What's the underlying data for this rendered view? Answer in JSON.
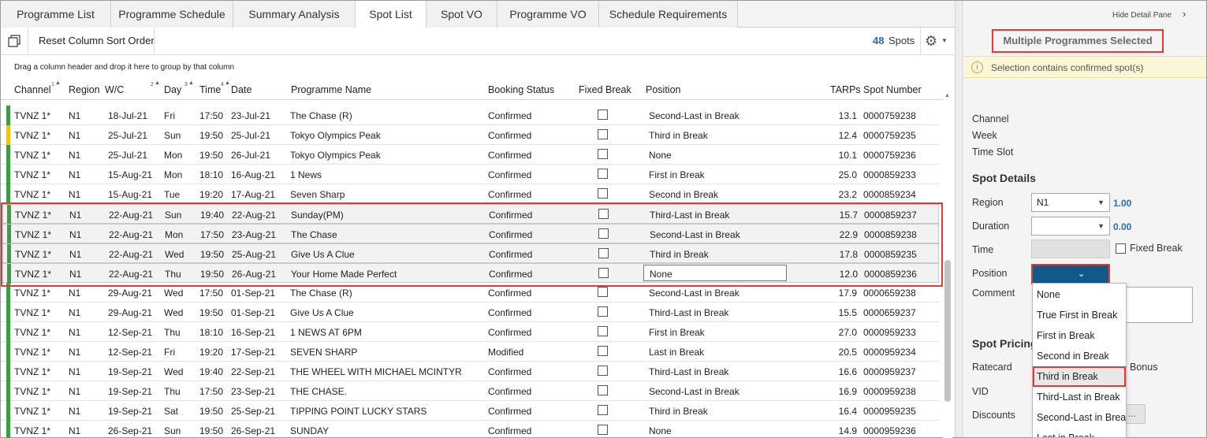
{
  "tabs": [
    {
      "label": "Programme List",
      "active": false
    },
    {
      "label": "Programme Schedule",
      "active": false
    },
    {
      "label": "Summary Analysis",
      "active": false
    },
    {
      "label": "Spot List",
      "active": true
    },
    {
      "label": "Spot VO",
      "active": false
    },
    {
      "label": "Programme VO",
      "active": false
    },
    {
      "label": "Schedule Requirements",
      "active": false
    }
  ],
  "toolbar": {
    "copy_icon": "copy-icon",
    "reset_label": "Reset Column Sort Order",
    "spot_count": "48",
    "spots_label": "Spots",
    "settings_icon": "gear-icon"
  },
  "group_hint": "Drag a column header and drop it here to group by that column",
  "columns": {
    "channel": "Channel",
    "region": "Region",
    "wc": "W/C",
    "day": "Day",
    "time": "Time",
    "date": "Date",
    "programme": "Programme Name",
    "booking": "Booking Status",
    "fixed_break": "Fixed Break",
    "position": "Position",
    "tarps": "TARPs",
    "spot_number": "Spot Number"
  },
  "sort_marks": {
    "channel": "1",
    "wc": "2",
    "day": "3",
    "time": "4"
  },
  "rows": [
    {
      "channel": "TVNZ 1*",
      "region": "N1",
      "wc": "18-Jul-21",
      "day": "Fri",
      "time": "17:50",
      "date": "23-Jul-21",
      "programme": "The Chase (R)",
      "booking": "Confirmed",
      "position": "Second-Last in Break",
      "tarps": "13.1",
      "spot_number": "0000759238",
      "stripe": "green",
      "selected": false
    },
    {
      "channel": "TVNZ 1*",
      "region": "N1",
      "wc": "25-Jul-21",
      "day": "Sun",
      "time": "19:50",
      "date": "25-Jul-21",
      "programme": "Tokyo Olympics Peak",
      "booking": "Confirmed",
      "position": "Third in Break",
      "tarps": "12.4",
      "spot_number": "0000759235",
      "stripe": "yellow",
      "selected": false
    },
    {
      "channel": "TVNZ 1*",
      "region": "N1",
      "wc": "25-Jul-21",
      "day": "Mon",
      "time": "19:50",
      "date": "26-Jul-21",
      "programme": "Tokyo Olympics Peak",
      "booking": "Confirmed",
      "position": "None",
      "tarps": "10.1",
      "spot_number": "0000759236",
      "stripe": "green",
      "selected": false
    },
    {
      "channel": "TVNZ 1*",
      "region": "N1",
      "wc": "15-Aug-21",
      "day": "Mon",
      "time": "18:10",
      "date": "16-Aug-21",
      "programme": "1 News",
      "booking": "Confirmed",
      "position": "First in Break",
      "tarps": "25.0",
      "spot_number": "0000859233",
      "stripe": "green",
      "selected": false
    },
    {
      "channel": "TVNZ 1*",
      "region": "N1",
      "wc": "15-Aug-21",
      "day": "Tue",
      "time": "19:20",
      "date": "17-Aug-21",
      "programme": "Seven Sharp",
      "booking": "Confirmed",
      "position": "Second in Break",
      "tarps": "23.2",
      "spot_number": "0000859234",
      "stripe": "green",
      "selected": false
    },
    {
      "channel": "TVNZ 1*",
      "region": "N1",
      "wc": "22-Aug-21",
      "day": "Sun",
      "time": "19:40",
      "date": "22-Aug-21",
      "programme": "Sunday(PM)",
      "booking": "Confirmed",
      "position": "Third-Last in Break",
      "tarps": "15.7",
      "spot_number": "0000859237",
      "stripe": "green",
      "selected": true
    },
    {
      "channel": "TVNZ 1*",
      "region": "N1",
      "wc": "22-Aug-21",
      "day": "Mon",
      "time": "17:50",
      "date": "23-Aug-21",
      "programme": "The Chase",
      "booking": "Confirmed",
      "position": "Second-Last in Break",
      "tarps": "22.9",
      "spot_number": "0000859238",
      "stripe": "green",
      "selected": true
    },
    {
      "channel": "TVNZ 1*",
      "region": "N1",
      "wc": "22-Aug-21",
      "day": "Wed",
      "time": "19:50",
      "date": "25-Aug-21",
      "programme": "Give Us A Clue",
      "booking": "Confirmed",
      "position": "Third in Break",
      "tarps": "17.8",
      "spot_number": "0000859235",
      "stripe": "green",
      "selected": true
    },
    {
      "channel": "TVNZ 1*",
      "region": "N1",
      "wc": "22-Aug-21",
      "day": "Thu",
      "time": "19:50",
      "date": "26-Aug-21",
      "programme": "Your Home Made Perfect",
      "booking": "Confirmed",
      "position": "None",
      "tarps": "12.0",
      "spot_number": "0000859236",
      "stripe": "green",
      "selected": true,
      "editing": true
    },
    {
      "channel": "TVNZ 1*",
      "region": "N1",
      "wc": "29-Aug-21",
      "day": "Wed",
      "time": "17:50",
      "date": "01-Sep-21",
      "programme": "The Chase (R)",
      "booking": "Confirmed",
      "position": "Second-Last in Break",
      "tarps": "17.9",
      "spot_number": "0000659238",
      "stripe": "green",
      "selected": false
    },
    {
      "channel": "TVNZ 1*",
      "region": "N1",
      "wc": "29-Aug-21",
      "day": "Wed",
      "time": "19:50",
      "date": "01-Sep-21",
      "programme": "Give Us A Clue",
      "booking": "Confirmed",
      "position": "Third-Last in Break",
      "tarps": "15.5",
      "spot_number": "0000659237",
      "stripe": "green",
      "selected": false
    },
    {
      "channel": "TVNZ 1*",
      "region": "N1",
      "wc": "12-Sep-21",
      "day": "Thu",
      "time": "18:10",
      "date": "16-Sep-21",
      "programme": "1 NEWS AT 6PM",
      "booking": "Confirmed",
      "position": "First in Break",
      "tarps": "27.0",
      "spot_number": "0000959233",
      "stripe": "green",
      "selected": false
    },
    {
      "channel": "TVNZ 1*",
      "region": "N1",
      "wc": "12-Sep-21",
      "day": "Fri",
      "time": "19:20",
      "date": "17-Sep-21",
      "programme": "SEVEN SHARP",
      "booking": "Modified",
      "position": "Last in Break",
      "tarps": "20.5",
      "spot_number": "0000959234",
      "stripe": "green",
      "selected": false
    },
    {
      "channel": "TVNZ 1*",
      "region": "N1",
      "wc": "19-Sep-21",
      "day": "Wed",
      "time": "19:40",
      "date": "22-Sep-21",
      "programme": "THE WHEEL WITH MICHAEL MCINTYR",
      "booking": "Confirmed",
      "position": "Third-Last in Break",
      "tarps": "16.6",
      "spot_number": "0000959237",
      "stripe": "green",
      "selected": false
    },
    {
      "channel": "TVNZ 1*",
      "region": "N1",
      "wc": "19-Sep-21",
      "day": "Thu",
      "time": "17:50",
      "date": "23-Sep-21",
      "programme": "THE CHASE.",
      "booking": "Confirmed",
      "position": "Second-Last in Break",
      "tarps": "16.9",
      "spot_number": "0000959238",
      "stripe": "green",
      "selected": false
    },
    {
      "channel": "TVNZ 1*",
      "region": "N1",
      "wc": "19-Sep-21",
      "day": "Sat",
      "time": "19:50",
      "date": "25-Sep-21",
      "programme": "TIPPING POINT LUCKY STARS",
      "booking": "Confirmed",
      "position": "Third in Break",
      "tarps": "16.4",
      "spot_number": "0000959235",
      "stripe": "green",
      "selected": false
    },
    {
      "channel": "TVNZ 1*",
      "region": "N1",
      "wc": "26-Sep-21",
      "day": "Sun",
      "time": "19:50",
      "date": "26-Sep-21",
      "programme": "SUNDAY",
      "booking": "Confirmed",
      "position": "None",
      "tarps": "14.9",
      "spot_number": "0000959236",
      "stripe": "green",
      "selected": false
    }
  ],
  "detail": {
    "hide_pane": "Hide Detail Pane",
    "title": "Multiple Programmes Selected",
    "warning": "Selection contains confirmed spot(s)",
    "channel_label": "Channel",
    "week_label": "Week",
    "timeslot_label": "Time Slot",
    "spot_details": "Spot Details",
    "region_label": "Region",
    "region_value": "N1",
    "region_number": "1.00",
    "duration_label": "Duration",
    "duration_value": "",
    "duration_number": "0.00",
    "time_label": "Time",
    "fixed_break_label": "Fixed Break",
    "position_label": "Position",
    "comment_label": "Comment",
    "spot_pricing": "Spot Pricing",
    "ratecard_label": "Ratecard",
    "bonus_label": "Bonus",
    "vid_label": "VID",
    "discounts_label": "Discounts",
    "discounts_button": "..."
  },
  "position_options": [
    "None",
    "True First in Break",
    "First in Break",
    "Second in Break",
    "Third in Break",
    "Third-Last in Break",
    "Second-Last in Break",
    "Last in Break"
  ],
  "position_highlighted": "Third in Break",
  "colors": {
    "stripe_green": "#3a9e44",
    "stripe_yellow": "#f2c21b",
    "accent_blue": "#2170b8",
    "highlight_red": "#e53935",
    "dropdown_blue": "#0f5a8a"
  }
}
